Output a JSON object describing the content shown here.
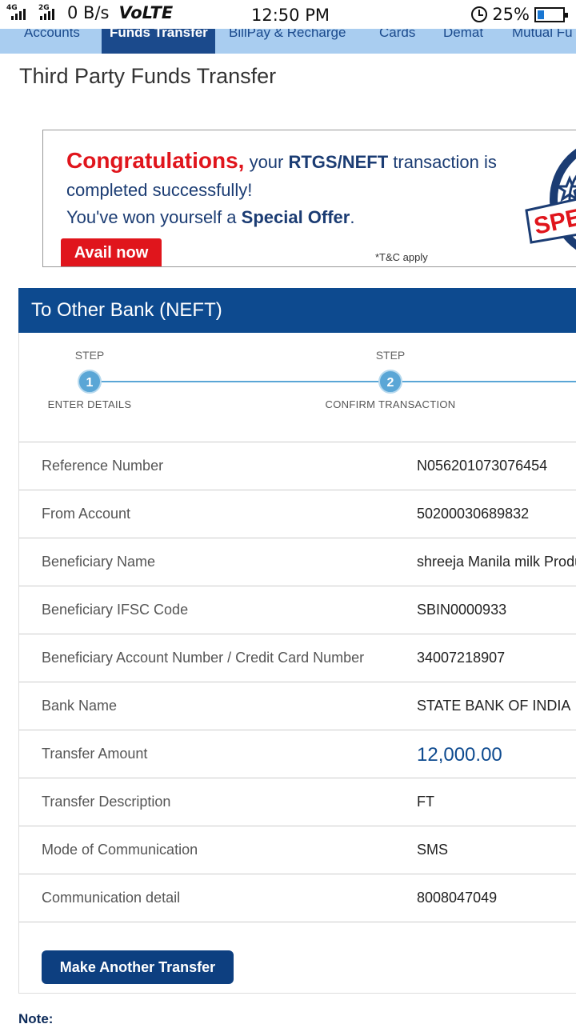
{
  "status_bar": {
    "net1": "4G",
    "net2": "2G",
    "speed": "0 B/s",
    "volte": "VoLTE",
    "time": "12:50 PM",
    "battery": "25%",
    "battery_level": 0.25
  },
  "tabs": [
    {
      "label": "Accounts"
    },
    {
      "label": "Funds Transfer",
      "active": true
    },
    {
      "label": "BillPay & Recharge"
    },
    {
      "label": "Cards"
    },
    {
      "label": "Demat"
    },
    {
      "label": "Mutual Fu"
    }
  ],
  "page_title": "Third Party Funds Transfer",
  "promo": {
    "congrats": "Congratulations,",
    "line1_pre": " your ",
    "line1_bold": "RTGS/NEFT",
    "line1_post": " transaction is",
    "line2": "completed successfully!",
    "line3_pre": "You've won yourself a ",
    "line3_bold": "Special Offer",
    "line3_post": ".",
    "cta": "Avail now",
    "tnc": "*T&C apply",
    "stamp_text": "SPE"
  },
  "section_title": "To Other Bank (NEFT)",
  "stepper": {
    "steps": [
      {
        "label": "STEP",
        "number": "1",
        "name": "ENTER DETAILS"
      },
      {
        "label": "STEP",
        "number": "2",
        "name": "CONFIRM TRANSACTION"
      }
    ]
  },
  "details": [
    {
      "label": "Reference Number",
      "value": "N056201073076454"
    },
    {
      "label": "From Account",
      "value": "50200030689832"
    },
    {
      "label": "Beneficiary Name",
      "value": "shreeja Manila milk Produ"
    },
    {
      "label": "Beneficiary IFSC Code",
      "value": "SBIN0000933"
    },
    {
      "label": "Beneficiary Account Number / Credit Card Number",
      "value": "34007218907"
    },
    {
      "label": "Bank Name",
      "value": "STATE BANK OF INDIA"
    },
    {
      "label": "Transfer Amount",
      "value": "12,000.00"
    },
    {
      "label": "Transfer Description",
      "value": "FT"
    },
    {
      "label": "Mode of Communication",
      "value": "SMS"
    },
    {
      "label": "Communication detail",
      "value": "8008047049"
    }
  ],
  "make_another_button": "Make Another Transfer",
  "note_label": "Note:",
  "colors": {
    "primary": "#0d4a8f",
    "tab_bg": "#a9cdf0",
    "promo_red": "#e0151c",
    "step_blue": "#5aa6d6"
  }
}
